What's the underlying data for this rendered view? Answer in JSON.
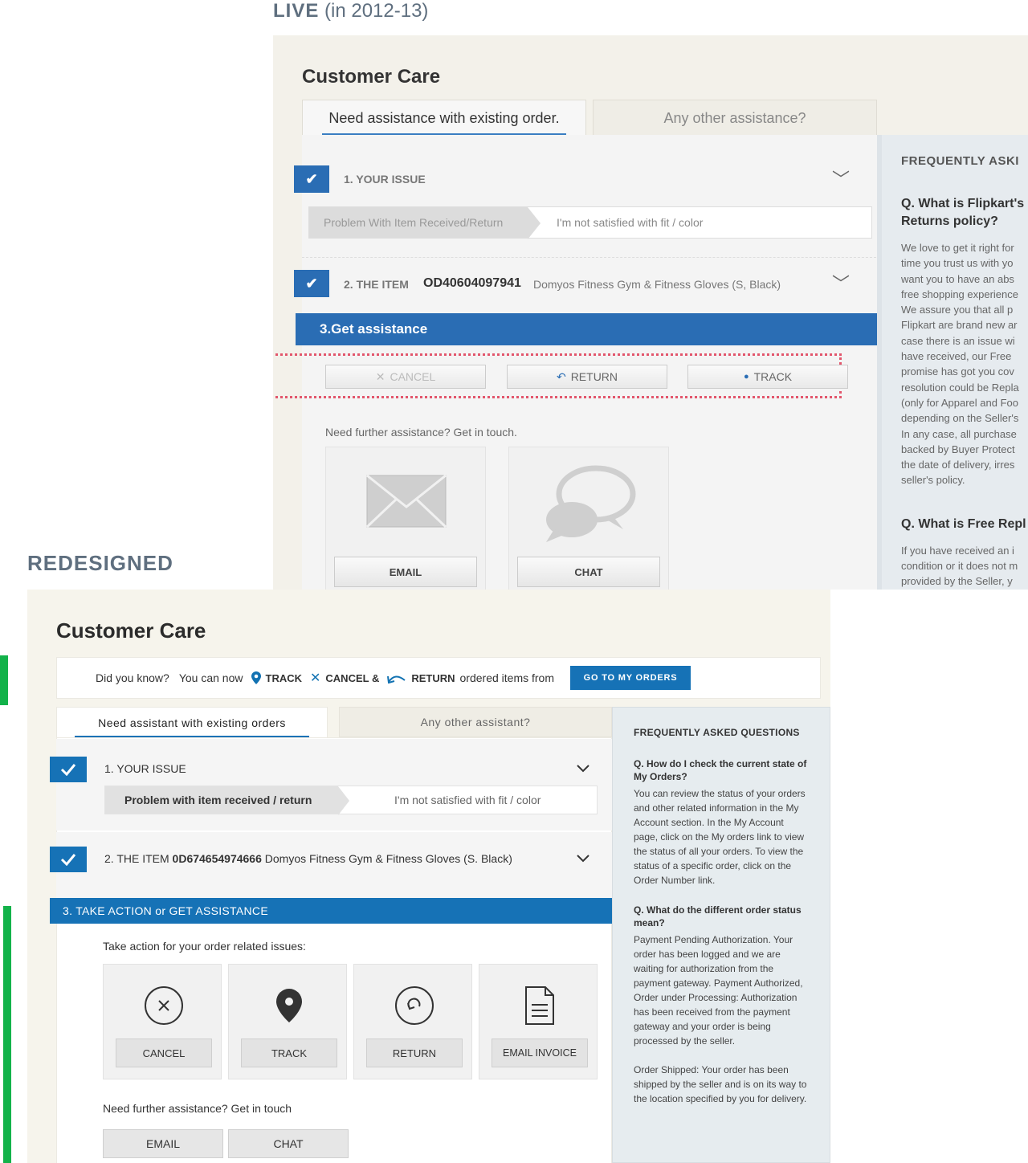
{
  "captions": {
    "live_bold": "LIVE",
    "live_rest": "(in 2012-13)",
    "redesigned": "REDESIGNED"
  },
  "live": {
    "title": "Customer Care",
    "tabs": [
      "Need assistance with existing order.",
      "Any other assistance?"
    ],
    "step1": {
      "label": "1. YOUR ISSUE",
      "crumb": "Problem With Item Received/Return",
      "value": "I'm not satisfied with fit / color"
    },
    "step2": {
      "label": "2. THE ITEM",
      "order_id": "OD40604097941",
      "item": "Domyos Fitness Gym & Fitness Gloves (S, Black)"
    },
    "step3": {
      "label": "3.Get assistance"
    },
    "actions": [
      "CANCEL",
      "RETURN",
      "TRACK"
    ],
    "need": "Need further assistance? Get in touch.",
    "contact": [
      "EMAIL",
      "CHAT"
    ],
    "faq": {
      "heading": "FREQUENTLY ASKI",
      "q1": [
        "Q. What is Flipkart's",
        "Returns policy?"
      ],
      "a1": [
        "We love to get it right for",
        "time you trust us with yo",
        "want you to have an abs",
        "free shopping experience",
        "We assure you that all p",
        "Flipkart are brand new ar",
        "case there is an issue wi",
        "have received, our Free",
        "promise has got you cov",
        "resolution could be Repla",
        "(only for Apparel and Foo",
        "depending on the Seller's",
        "In any case, all purchase",
        "backed by Buyer Protect",
        "the date of delivery, irres",
        "seller's policy."
      ],
      "q2": "Q. What is Free Repl",
      "a2": [
        "If you have received an i",
        "condition or it does not m",
        "provided by the Seller, y"
      ]
    }
  },
  "redesigned": {
    "title": "Customer Care",
    "know": {
      "prefix": "Did you know?",
      "text1": "You can now",
      "track": "TRACK",
      "cancel": "CANCEL &",
      "return": "RETURN",
      "text2": "ordered items from",
      "button": "GO TO MY ORDERS"
    },
    "tabs": [
      "Need assistant with existing orders",
      "Any other assistant?"
    ],
    "step1": {
      "label": "1. YOUR ISSUE",
      "crumb": "Problem with item received / return",
      "value": "I'm not satisfied with fit / color"
    },
    "step2": {
      "label": "2. THE ITEM",
      "order_id": "0D674654974666",
      "item": "Domyos Fitness Gym & Fitness Gloves (S. Black)"
    },
    "step3": {
      "label": "3. TAKE ACTION or GET ASSISTANCE"
    },
    "take": "Take action for your order related issues:",
    "actions": [
      "CANCEL",
      "TRACK",
      "RETURN",
      "EMAIL INVOICE"
    ],
    "need": "Need further assistance? Get in touch",
    "contact": [
      "EMAIL",
      "CHAT"
    ],
    "faq": {
      "heading": "FREQUENTLY ASKED QUESTIONS",
      "q1": "Q. How do I check the current state of My Orders?",
      "a1": "You can review the status of your orders and other related information in the My Account section. In the My Account page, click on the My orders link to view the status of all your orders. To view the status of a specific order, click on the Order Number link.",
      "q2": "Q. What do the different order status mean?",
      "a2": "Payment Pending Authorization. Your order has been logged and we are waiting for authorization from the payment gateway. Payment Authorized, Order under Processing: Authorization has been received from the payment gateway and your order is being processed by the seller.",
      "a3": "Order Shipped: Your order has been shipped by the seller and is on its way to the location specified by you for delivery."
    }
  },
  "colors": {
    "accent": "#1672b6",
    "live_accent": "#2a6db4",
    "highlight": "#e2566c",
    "marker": "#13b24a"
  }
}
